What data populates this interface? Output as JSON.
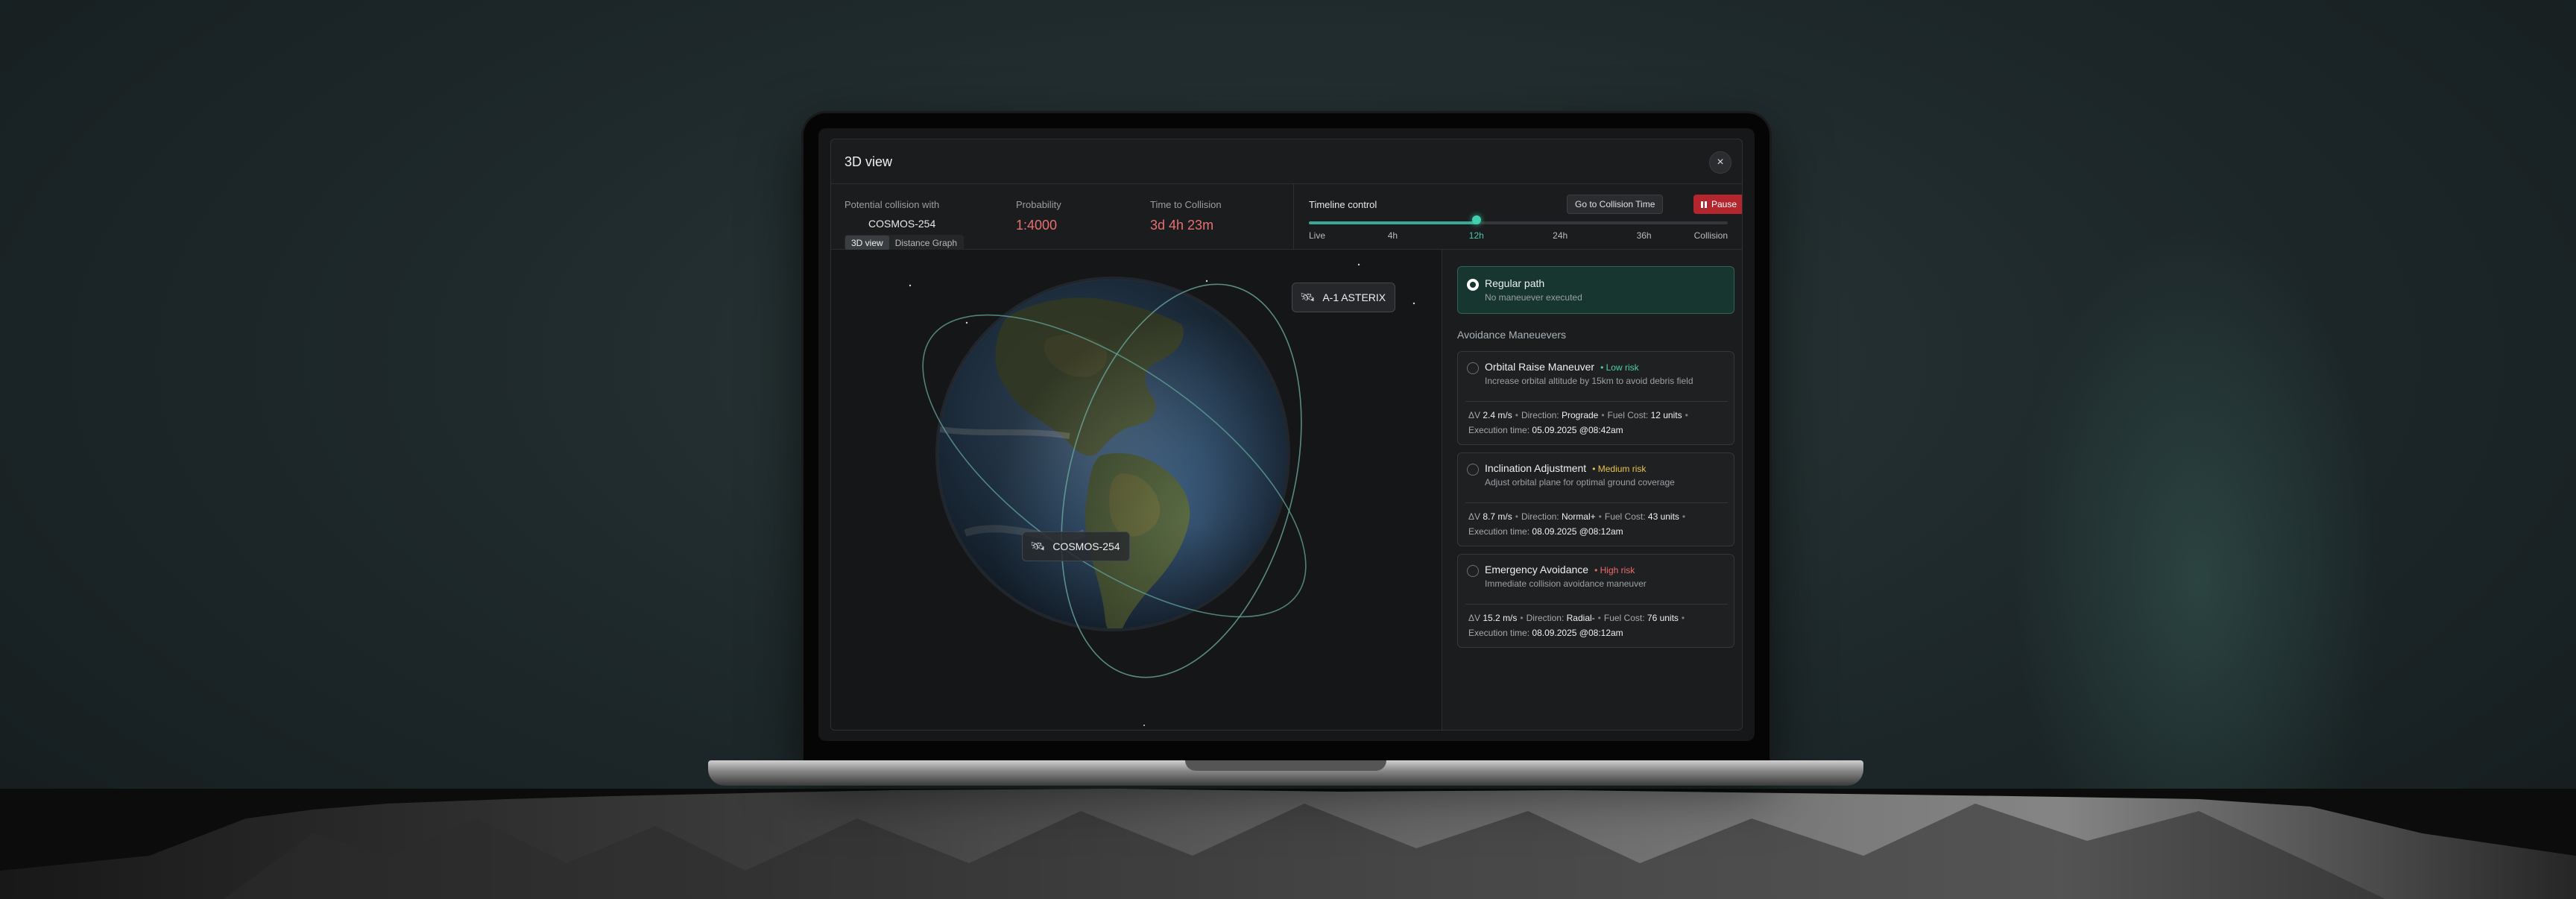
{
  "modal": {
    "title": "3D view",
    "close_icon": "×"
  },
  "info": {
    "collision_label": "Potential collision with",
    "collision_value": "COSMOS-254",
    "probability_label": "Probability",
    "probability_value": "1:4000",
    "ttc_label": "Time to Collision",
    "ttc_value": "3d 4h 23m",
    "tabs": [
      {
        "label": "3D view",
        "active": true
      },
      {
        "label": "Distance Graph",
        "active": false
      }
    ]
  },
  "timeline": {
    "label": "Timeline control",
    "go_button": "Go to Collision Time",
    "pause_button": "Pause",
    "progress": 0.4,
    "ticks": [
      "Live",
      "4h",
      "12h",
      "24h",
      "36h",
      "Collision"
    ],
    "active_tick": "12h"
  },
  "view": {
    "satellite_a": "A-1 ASTERIX",
    "satellite_b": "COSMOS-254"
  },
  "panel": {
    "regular": {
      "title": "Regular path",
      "subtitle": "No maneuever executed",
      "selected": true
    },
    "section_title": "Avoidance Maneuevers",
    "maneuvers": [
      {
        "title": "Orbital Raise Maneuver",
        "risk": "Low risk",
        "desc": "Increase orbital altitude by 15km to avoid debris field",
        "dv_label": "ΔV",
        "dv": "2.4 m/s",
        "direction_label": "Direction:",
        "direction": "Prograde",
        "fuel_label": "Fuel Cost:",
        "fuel": "12 units",
        "exec_label": "Execution time:",
        "exec": "05.09.2025 @08:42am"
      },
      {
        "title": "Inclination Adjustment",
        "risk": "Medium risk",
        "desc": "Adjust orbital plane for optimal ground coverage",
        "dv_label": "ΔV",
        "dv": "8.7 m/s",
        "direction_label": "Direction:",
        "direction": "Normal+",
        "fuel_label": "Fuel Cost:",
        "fuel": "43 units",
        "exec_label": "Execution time:",
        "exec": "08.09.2025 @08:12am"
      },
      {
        "title": "Emergency Avoidance",
        "risk": "High risk",
        "desc": "Immediate collision avoidance maneuver",
        "dv_label": "ΔV",
        "dv": "15.2 m/s",
        "direction_label": "Direction:",
        "direction": "Radial-",
        "fuel_label": "Fuel Cost:",
        "fuel": "76 units",
        "exec_label": "Execution time:",
        "exec": "08.09.2025 @08:12am"
      }
    ]
  },
  "colors": {
    "accent": "#3fd0b0",
    "danger": "#b3262e",
    "low_risk": "#4fd1a5",
    "medium_risk": "#e8c44a",
    "high_risk": "#ef6b6b"
  }
}
